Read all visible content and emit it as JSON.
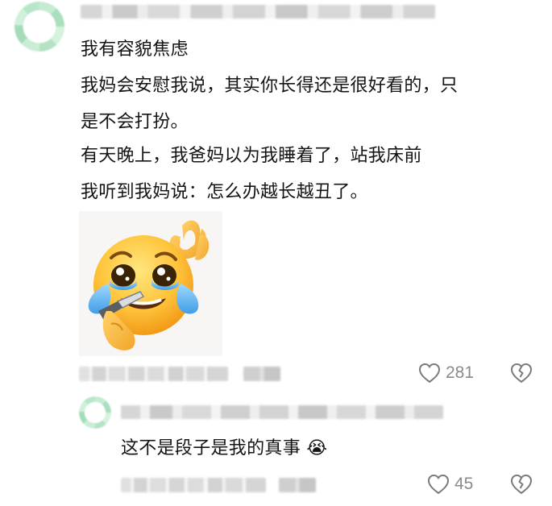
{
  "comment": {
    "lines": [
      "我有容貌焦虑",
      "我妈会安慰我说，其实你长得还是很好看的，只",
      "是不会打扮。",
      "有天晚上，我爸妈以为我睡着了，站我床前",
      "我听到我妈说：怎么办越长越丑了。"
    ],
    "sticker_icon": "crying-laughing-emoji-ok-hand-sticker",
    "likes": "281",
    "like_icon": "heart-outline-icon",
    "dislike_icon": "broken-heart-outline-icon"
  },
  "reply": {
    "text": "这不是段子是我的真事",
    "emoji": "😭",
    "likes": "45",
    "like_icon": "heart-outline-icon",
    "dislike_icon": "broken-heart-outline-icon"
  },
  "colors": {
    "text": "#141414",
    "muted": "#8a8a8a",
    "avatar_accent": "#a9dfbd"
  }
}
